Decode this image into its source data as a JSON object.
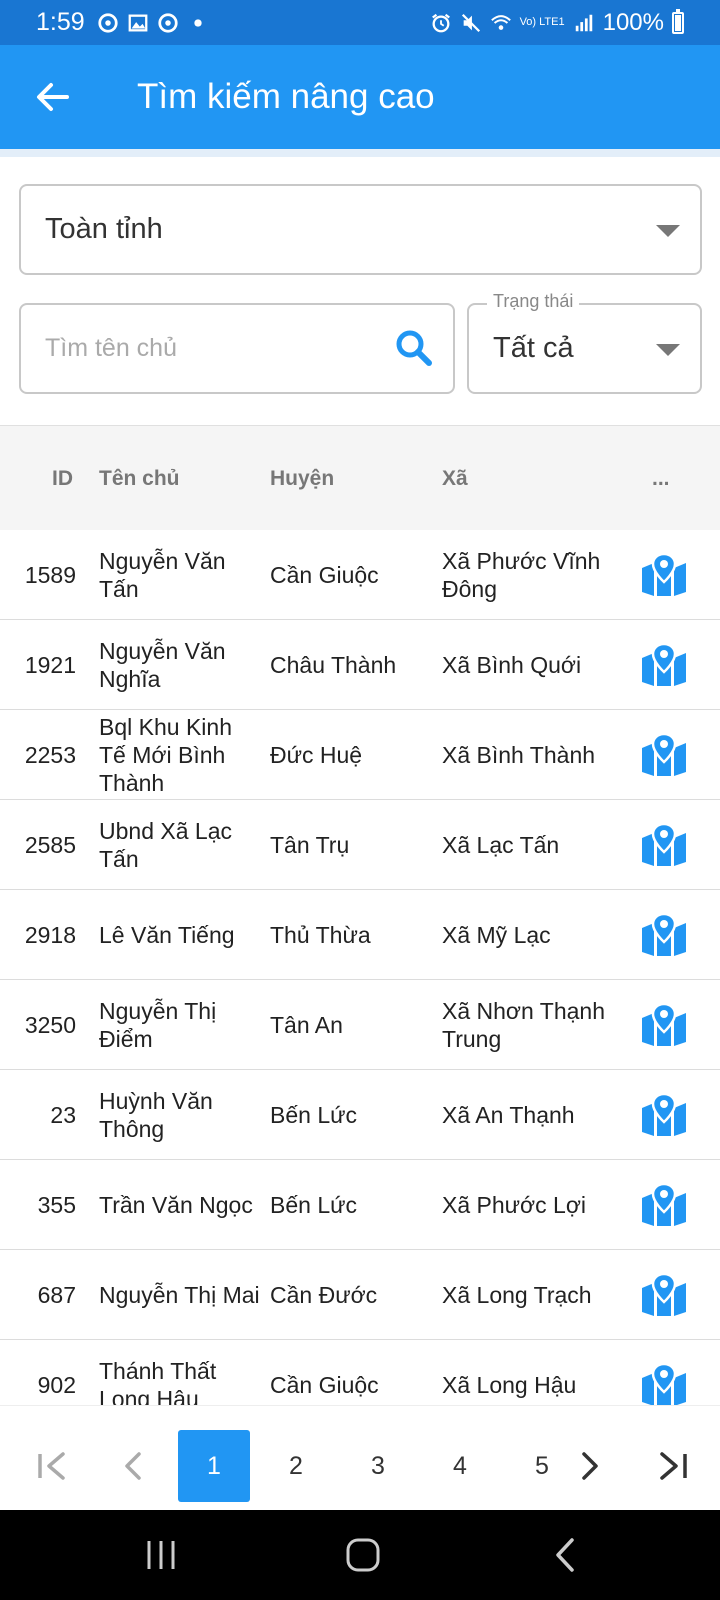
{
  "status_bar": {
    "time": "1:59",
    "battery": "100%",
    "left_icons": [
      "soccer-ball-icon",
      "image-icon",
      "soccer-ball-icon",
      "dot-icon"
    ],
    "right_icons": [
      "alarm-icon",
      "mute-icon",
      "wifi-calling-icon",
      "signal-icon",
      "battery-icon"
    ],
    "network_text": "Vo) LTE1"
  },
  "app_bar": {
    "title": "Tìm kiếm nâng cao",
    "back_icon": "arrow-left-icon",
    "color": "#2196f3"
  },
  "filters": {
    "region_select": {
      "value": "Toàn tỉnh"
    },
    "search": {
      "placeholder": "Tìm tên chủ",
      "value": ""
    },
    "status_select": {
      "label": "Trạng thái",
      "value": "Tất cả"
    }
  },
  "table": {
    "headers": {
      "id": "ID",
      "owner": "Tên chủ",
      "district": "Huyện",
      "commune": "Xã",
      "more": "..."
    },
    "rows": [
      {
        "id": "1589",
        "owner": "Nguyễn Văn Tấn",
        "district": "Cần Giuộc",
        "commune": "Xã Phước Vĩnh Đông"
      },
      {
        "id": "1921",
        "owner": "Nguyễn Văn Nghĩa",
        "district": "Châu Thành",
        "commune": "Xã Bình Quới"
      },
      {
        "id": "2253",
        "owner": "Bql Khu Kinh Tế Mới Bình Thành",
        "district": "Đức Huệ",
        "commune": "Xã Bình Thành"
      },
      {
        "id": "2585",
        "owner": "Ubnd Xã Lạc Tấn",
        "district": "Tân Trụ",
        "commune": "Xã Lạc Tấn"
      },
      {
        "id": "2918",
        "owner": "Lê Văn Tiếng",
        "district": "Thủ Thừa",
        "commune": "Xã Mỹ Lạc"
      },
      {
        "id": "3250",
        "owner": "Nguyễn Thị Điểm",
        "district": "Tân An",
        "commune": "Xã Nhơn Thạnh Trung"
      },
      {
        "id": "23",
        "owner": "Huỳnh Văn Thông",
        "district": "Bến Lức",
        "commune": "Xã An Thạnh"
      },
      {
        "id": "355",
        "owner": "Trần Văn Ngọc",
        "district": "Bến Lức",
        "commune": "Xã Phước Lợi"
      },
      {
        "id": "687",
        "owner": "Nguyễn Thị Mai",
        "district": "Cần Đước",
        "commune": "Xã Long Trạch"
      },
      {
        "id": "902",
        "owner": "Thánh Thất Long Hậu",
        "district": "Cần Giuộc",
        "commune": "Xã Long Hậu"
      }
    ],
    "row_action_icon": "map-pin-icon",
    "accent_color": "#2196f3"
  },
  "pagination": {
    "pages": [
      "1",
      "2",
      "3",
      "4",
      "5"
    ],
    "current": "1",
    "icons": [
      "first-page-icon",
      "prev-page-icon",
      "next-page-icon",
      "last-page-icon"
    ]
  },
  "nav_bar": {
    "icons": [
      "recent-apps-icon",
      "home-icon",
      "back-icon"
    ]
  }
}
